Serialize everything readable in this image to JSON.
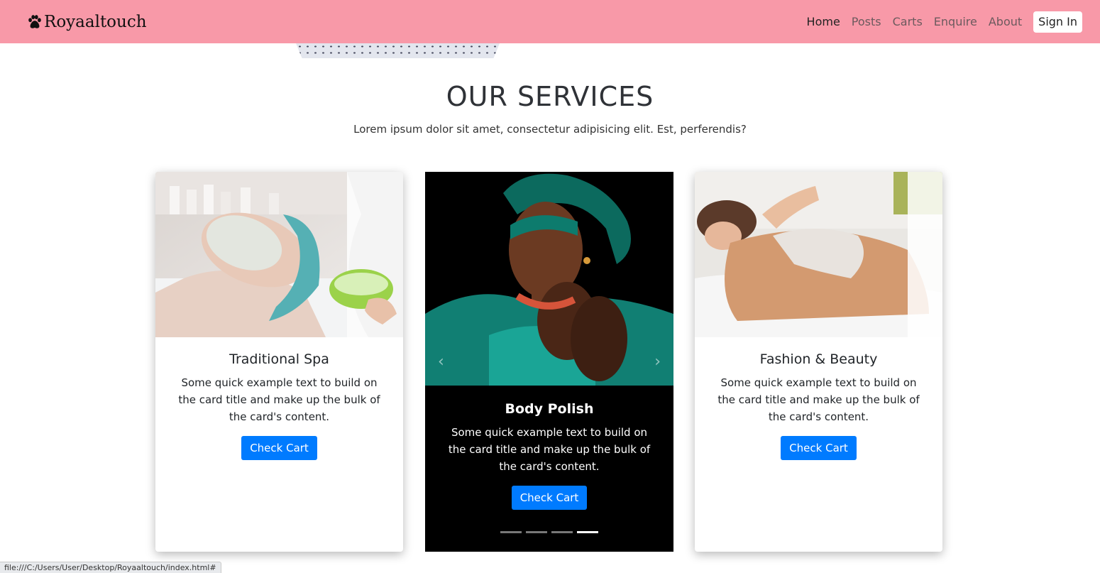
{
  "nav": {
    "brand": "Royaaltouch",
    "links": [
      "Home",
      "Posts",
      "Carts",
      "Enquire",
      "About"
    ],
    "signin_label": "Sign In"
  },
  "services": {
    "title": "OUR SERVICES",
    "subtitle": "Lorem ipsum dolor sit amet, consectetur adipisicing elit. Est, perferendis?",
    "cards": [
      {
        "title": "Traditional Spa",
        "text": "Some quick example text to build on the card title and make up the bulk of the card's content.",
        "button": "Check Cart"
      },
      {
        "title": "Body Polish",
        "text": "Some quick example text to build on the card title and make up the bulk of the card's content.",
        "button": "Check Cart"
      },
      {
        "title": "Fashion & Beauty",
        "text": "Some quick example text to build on the card title and make up the bulk of the card's content.",
        "button": "Check Cart"
      }
    ],
    "carousel_slides": 4,
    "carousel_active": 4
  },
  "statusbar": {
    "url": "file:///C:/Users/User/Desktop/Royaaltouch/index.html#"
  },
  "colors": {
    "navbar": "#f899a8",
    "button": "#007bff",
    "mid_card": "#000000"
  },
  "icons": {
    "brand": "paw-icon",
    "carousel_prev": "chevron-left-icon",
    "carousel_next": "chevron-right-icon"
  }
}
